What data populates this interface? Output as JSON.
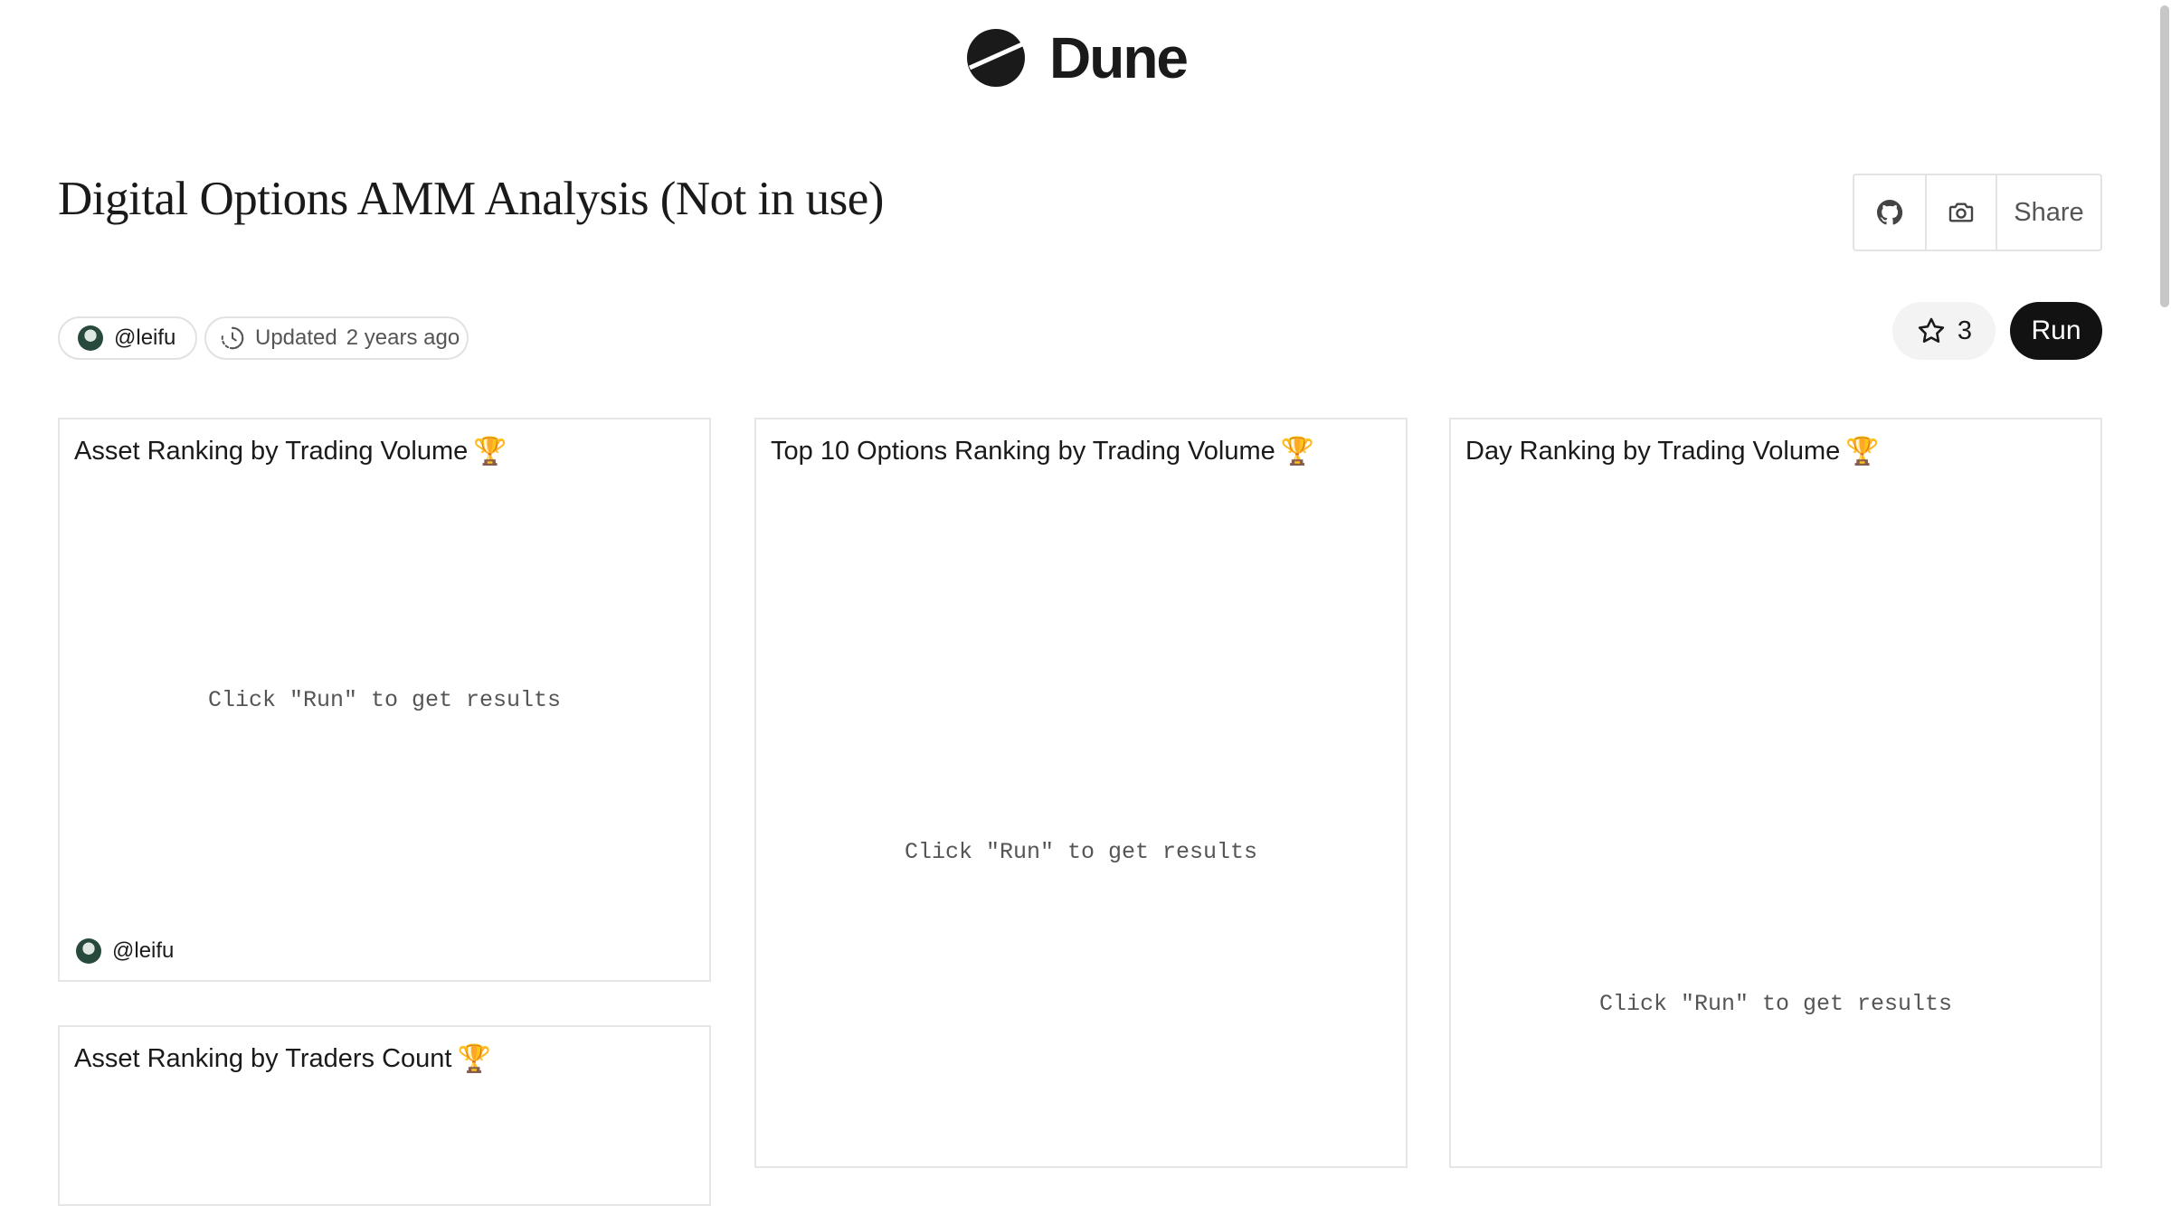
{
  "brand": {
    "name": "Dune",
    "logo_icon": "dune-logo-icon"
  },
  "dashboard": {
    "title": "Digital Options AMM Analysis (Not in use)",
    "author": "@leifu",
    "updated_label": "Updated",
    "updated_ago": "2 years ago",
    "star_count": "3"
  },
  "actions": {
    "github_icon": "github-icon",
    "screenshot_icon": "camera-icon",
    "share_label": "Share",
    "run_label": "Run"
  },
  "widgets": [
    {
      "title": "Asset Ranking by Trading Volume",
      "trophy": "🏆",
      "message": "Click \"Run\" to get results",
      "author": "@leifu"
    },
    {
      "title": "Top 10 Options Ranking by Trading Volume",
      "trophy": "🏆",
      "message": "Click \"Run\" to get results"
    },
    {
      "title": "Day Ranking by Trading Volume",
      "trophy": "🏆",
      "message": "Click \"Run\" to get results"
    },
    {
      "title": "Asset Ranking by Traders Count",
      "trophy": "🏆"
    }
  ]
}
